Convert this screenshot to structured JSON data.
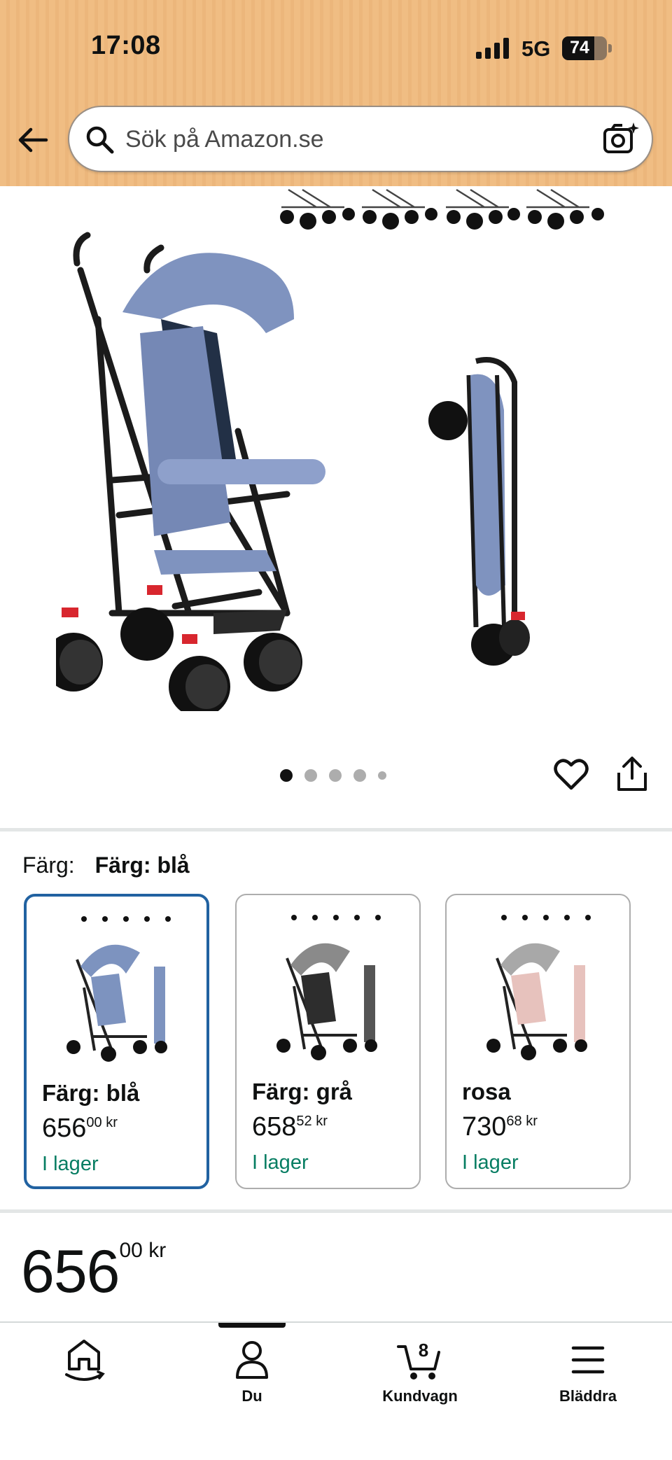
{
  "status_bar": {
    "time": "17:08",
    "network": "5G",
    "battery": "74"
  },
  "header": {
    "back_icon": "arrow-left-icon",
    "search": {
      "placeholder": "Sök på Amazon.se",
      "value": ""
    },
    "camera_icon": "camera-sparkle-icon"
  },
  "gallery": {
    "image_count": 5,
    "active_index": 0,
    "heart_icon": "heart-outline-icon",
    "share_icon": "share-icon"
  },
  "color_selector": {
    "label": "Färg:",
    "selected": "Färg: blå",
    "variants": [
      {
        "name": "Färg: blå",
        "price_whole": "656",
        "price_fraction": "00",
        "currency": "kr",
        "stock": "I lager",
        "color": "#7d93bf",
        "selected": true
      },
      {
        "name": "Färg: grå",
        "price_whole": "658",
        "price_fraction": "52",
        "currency": "kr",
        "stock": "I lager",
        "color": "#8a8a8a",
        "selected": false
      },
      {
        "name": "rosa",
        "price_whole": "730",
        "price_fraction": "68",
        "currency": "kr",
        "stock": "I lager",
        "color": "#e7c2bd",
        "selected": false
      }
    ]
  },
  "price": {
    "whole": "656",
    "fraction": "00",
    "currency": "kr"
  },
  "bottom_nav": {
    "items": [
      {
        "label": "",
        "icon": "home-smile-icon"
      },
      {
        "label": "Du",
        "icon": "person-icon"
      },
      {
        "label": "Kundvagn",
        "icon": "cart-icon",
        "badge": "8"
      },
      {
        "label": "Bläddra",
        "icon": "menu-icon"
      }
    ]
  },
  "colors": {
    "accent_selected": "#2162a1",
    "in_stock": "#067d62",
    "header_bg": "#f0bd83"
  }
}
